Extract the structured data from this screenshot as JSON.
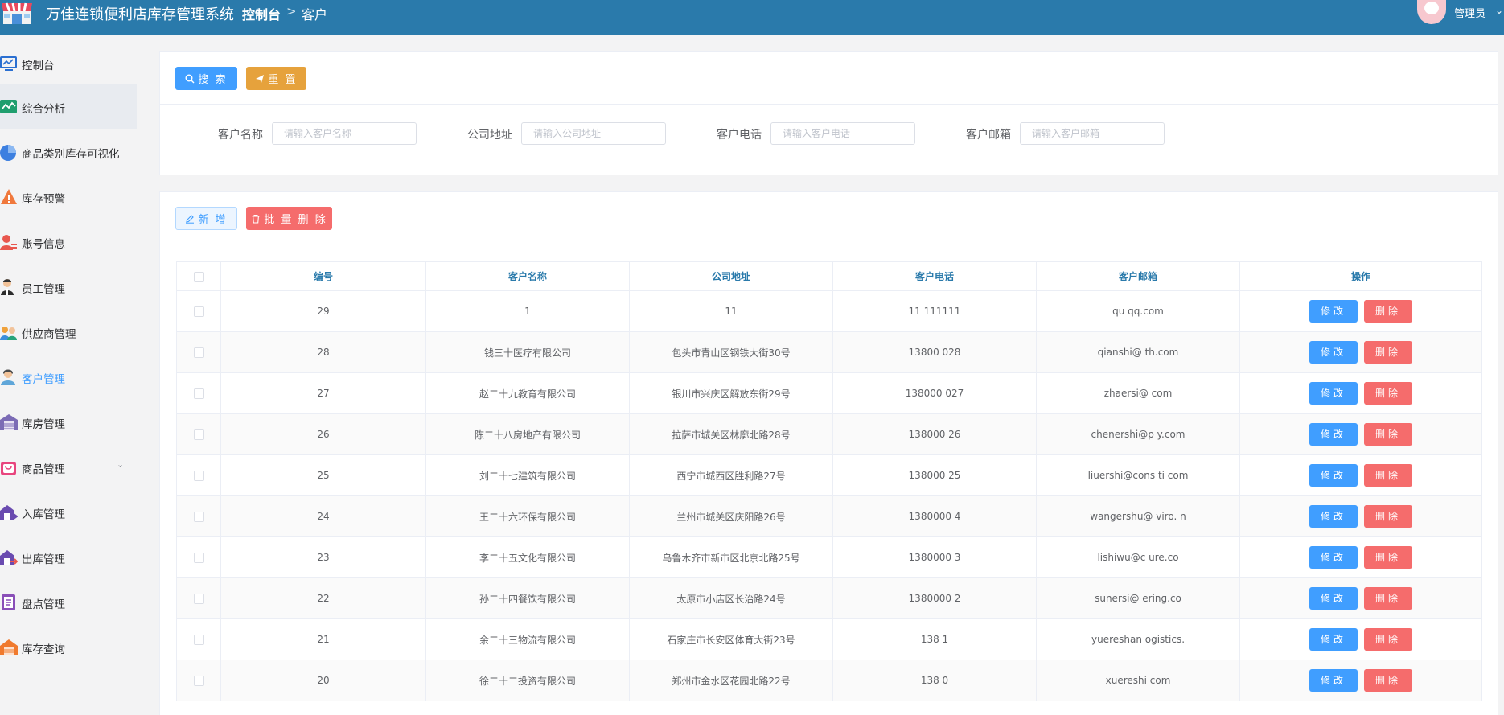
{
  "header": {
    "app_title": "万佳连锁便利店库存管理系统",
    "breadcrumb_home": "控制台",
    "breadcrumb_sep": ">",
    "breadcrumb_current": "客户",
    "user_name": "管理员",
    "user_caret": "⌄"
  },
  "sidebar": {
    "items": [
      {
        "label": "控制台",
        "icon": "monitor-icon"
      },
      {
        "label": "综合分析",
        "icon": "analysis-icon"
      },
      {
        "label": "商品类别库存可视化",
        "icon": "pie-chart-icon"
      },
      {
        "label": "库存预警",
        "icon": "warning-icon"
      },
      {
        "label": "账号信息",
        "icon": "account-icon"
      },
      {
        "label": "员工管理",
        "icon": "employee-icon"
      },
      {
        "label": "供应商管理",
        "icon": "supplier-icon"
      },
      {
        "label": "客户管理",
        "icon": "customer-icon"
      },
      {
        "label": "库房管理",
        "icon": "warehouse-icon"
      },
      {
        "label": "商品管理",
        "icon": "goods-icon"
      },
      {
        "label": "入库管理",
        "icon": "stock-in-icon"
      },
      {
        "label": "出库管理",
        "icon": "stock-out-icon"
      },
      {
        "label": "盘点管理",
        "icon": "inventory-check-icon"
      },
      {
        "label": "库存查询",
        "icon": "stock-query-icon"
      }
    ],
    "expand_caret": "⌄"
  },
  "search_card": {
    "search_label": "搜 索",
    "reset_label": "重 置",
    "fields": [
      {
        "label": "客户名称",
        "placeholder": "请输入客户名称",
        "value": ""
      },
      {
        "label": "公司地址",
        "placeholder": "请输入公司地址",
        "value": ""
      },
      {
        "label": "客户电话",
        "placeholder": "请输入客户电话",
        "value": ""
      },
      {
        "label": "客户邮箱",
        "placeholder": "请输入客户邮箱",
        "value": ""
      }
    ]
  },
  "table_card": {
    "add_label": "新 增",
    "batch_delete_label": "批 量 删 除",
    "columns": [
      "编号",
      "客户名称",
      "公司地址",
      "客户电话",
      "客户邮箱",
      "操作"
    ],
    "edit_label": "修改",
    "delete_label": "删除",
    "rows": [
      {
        "id": "29",
        "name": "1",
        "address": "11",
        "phone": "11 111111",
        "email": "qu qq.com"
      },
      {
        "id": "28",
        "name": "钱三十医疗有限公司",
        "address": "包头市青山区钢铁大街30号",
        "phone": "13800 028",
        "email": "qianshi@ th.com"
      },
      {
        "id": "27",
        "name": "赵二十九教育有限公司",
        "address": "银川市兴庆区解放东街29号",
        "phone": "138000 027",
        "email": "zhaersi@ com"
      },
      {
        "id": "26",
        "name": "陈二十八房地产有限公司",
        "address": "拉萨市城关区林廓北路28号",
        "phone": "138000 26",
        "email": "chenershi@p y.com"
      },
      {
        "id": "25",
        "name": "刘二十七建筑有限公司",
        "address": "西宁市城西区胜利路27号",
        "phone": "138000 25",
        "email": "liuershi@cons ti com"
      },
      {
        "id": "24",
        "name": "王二十六环保有限公司",
        "address": "兰州市城关区庆阳路26号",
        "phone": "1380000 4",
        "email": "wangershu@ viro. n"
      },
      {
        "id": "23",
        "name": "李二十五文化有限公司",
        "address": "乌鲁木齐市新市区北京北路25号",
        "phone": "1380000 3",
        "email": "lishiwu@c ure.co"
      },
      {
        "id": "22",
        "name": "孙二十四餐饮有限公司",
        "address": "太原市小店区长治路24号",
        "phone": "1380000 2",
        "email": "sunersi@ ering.co"
      },
      {
        "id": "21",
        "name": "余二十三物流有限公司",
        "address": "石家庄市长安区体育大街23号",
        "phone": "138 1",
        "email": "yuereshan ogistics."
      },
      {
        "id": "20",
        "name": "徐二十二投资有限公司",
        "address": "郑州市金水区花园北路22号",
        "phone": "138 0",
        "email": "xuereshi com"
      }
    ]
  },
  "colors": {
    "header_bg": "#2a7aab",
    "primary": "#409eff",
    "warning": "#e6a23c",
    "danger": "#f56c6c",
    "column_header_text": "#2a7aab"
  }
}
